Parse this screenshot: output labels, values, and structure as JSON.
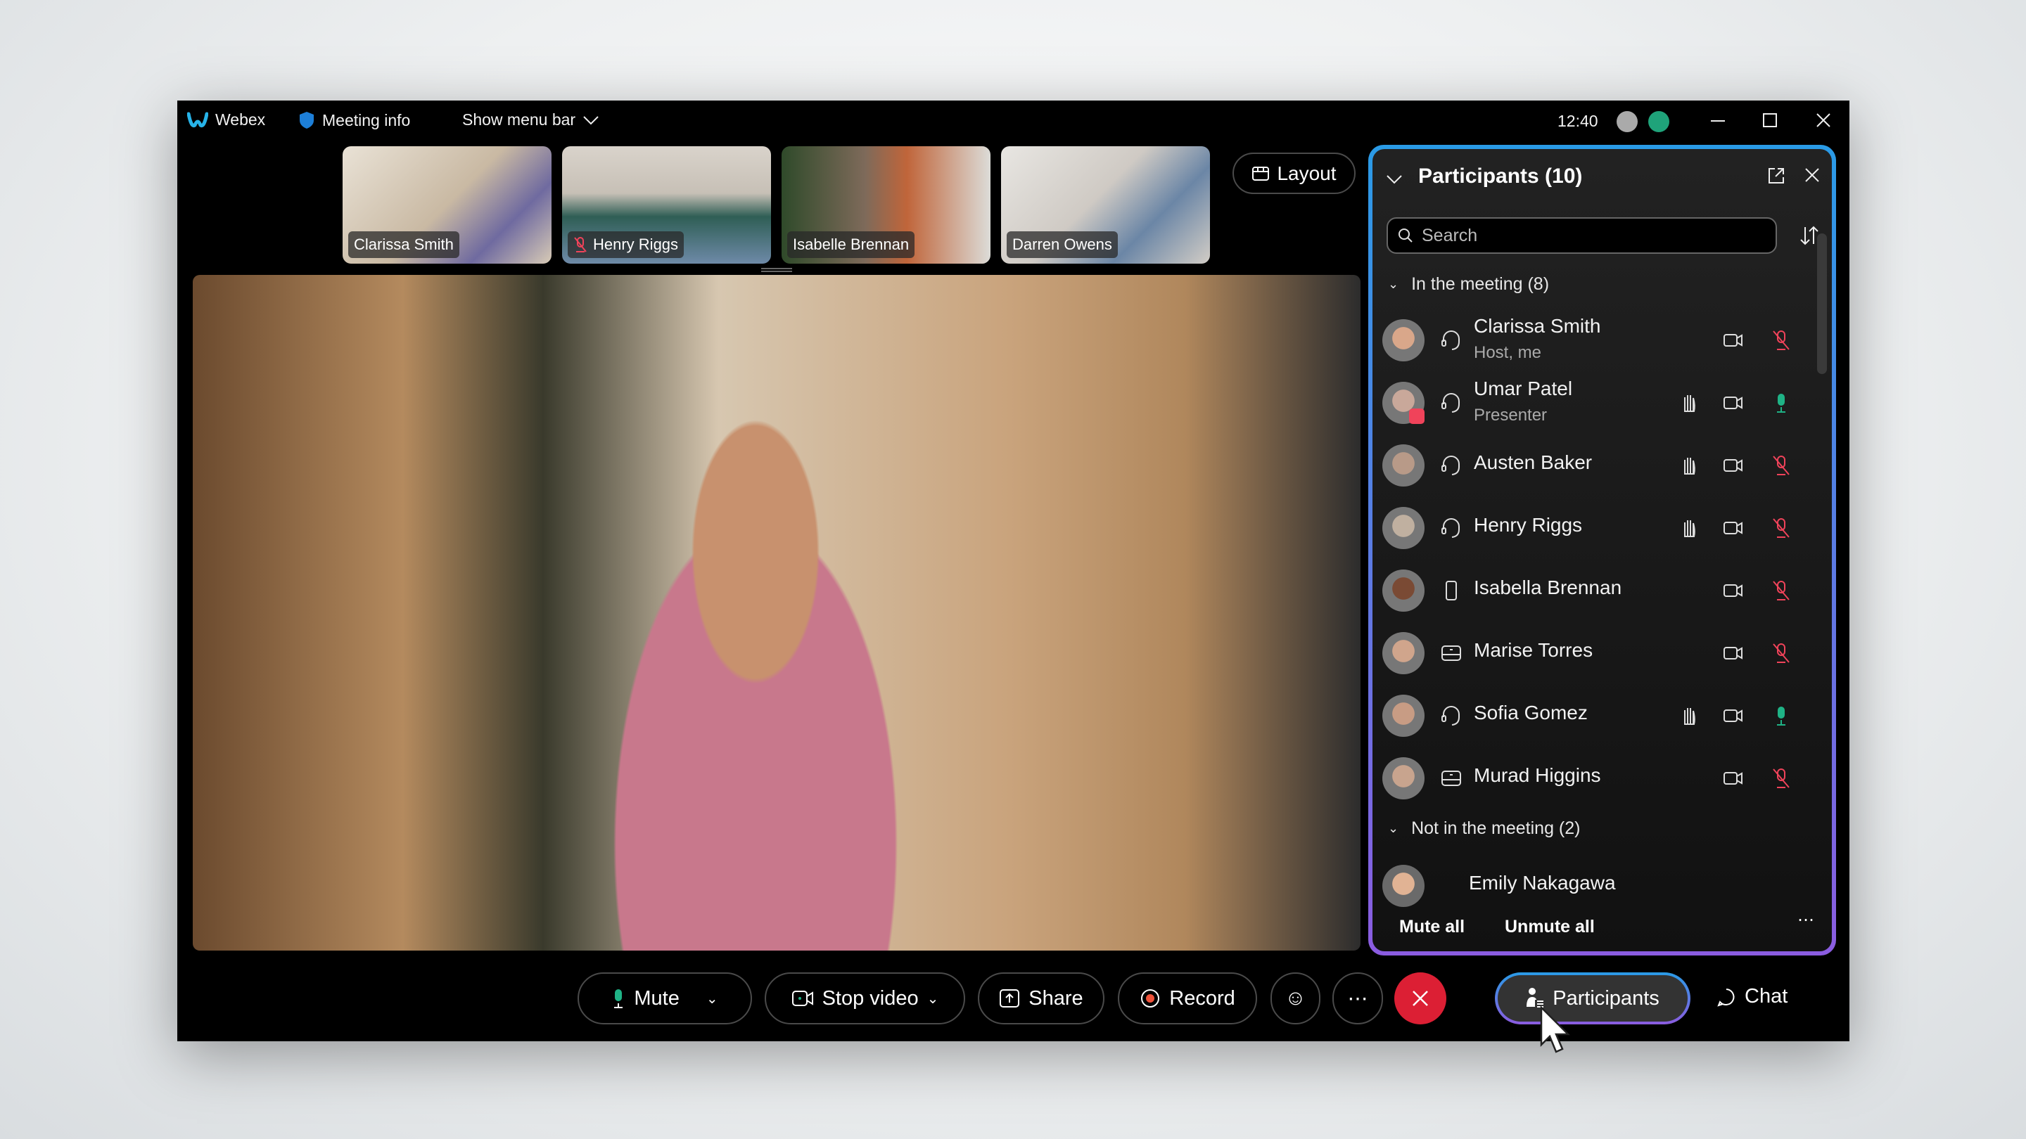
{
  "titlebar": {
    "app": "Webex",
    "meeting_info": "Meeting info",
    "show_menu_bar": "Show menu bar",
    "time": "12:40"
  },
  "thumbnails": [
    {
      "name": "Clarissa Smith",
      "muted": false
    },
    {
      "name": "Henry Riggs",
      "muted": true
    },
    {
      "name": "Isabelle Brennan",
      "muted": false
    },
    {
      "name": "Darren Owens",
      "muted": false
    }
  ],
  "layout_label": "Layout",
  "panel": {
    "title": "Participants (10)",
    "search_placeholder": "Search",
    "in_meeting": "In the meeting (8)",
    "not_in_meeting": "Not in the meeting (2)",
    "participants": [
      {
        "name": "Clarissa Smith",
        "role": "Host, me",
        "device": "headset",
        "hand": false,
        "mic": "muted"
      },
      {
        "name": "Umar Patel",
        "role": "Presenter",
        "device": "headset",
        "hand": true,
        "mic": "active",
        "presenting": true
      },
      {
        "name": "Austen Baker",
        "role": "",
        "device": "headset",
        "hand": true,
        "mic": "muted"
      },
      {
        "name": "Henry Riggs",
        "role": "",
        "device": "headset",
        "hand": true,
        "mic": "muted"
      },
      {
        "name": "Isabella Brennan",
        "role": "",
        "device": "phone",
        "hand": false,
        "mic": "muted"
      },
      {
        "name": "Marise Torres",
        "role": "",
        "device": "room",
        "hand": false,
        "mic": "muted"
      },
      {
        "name": "Sofia Gomez",
        "role": "",
        "device": "headset",
        "hand": true,
        "mic": "active"
      },
      {
        "name": "Murad Higgins",
        "role": "",
        "device": "room",
        "hand": false,
        "mic": "muted"
      }
    ],
    "not_joined": [
      {
        "name": "Emily Nakagawa"
      }
    ],
    "mute_all": "Mute all",
    "unmute_all": "Unmute all"
  },
  "toolbar": {
    "mute": "Mute",
    "stop_video": "Stop video",
    "share": "Share",
    "record": "Record",
    "participants": "Participants",
    "chat": "Chat"
  },
  "colors": {
    "accent_blue": "#2a9be6",
    "accent_purple": "#8b5ce0",
    "muted_red": "#f0435a",
    "active_green": "#1fb386",
    "end_red": "#dc1f34"
  }
}
